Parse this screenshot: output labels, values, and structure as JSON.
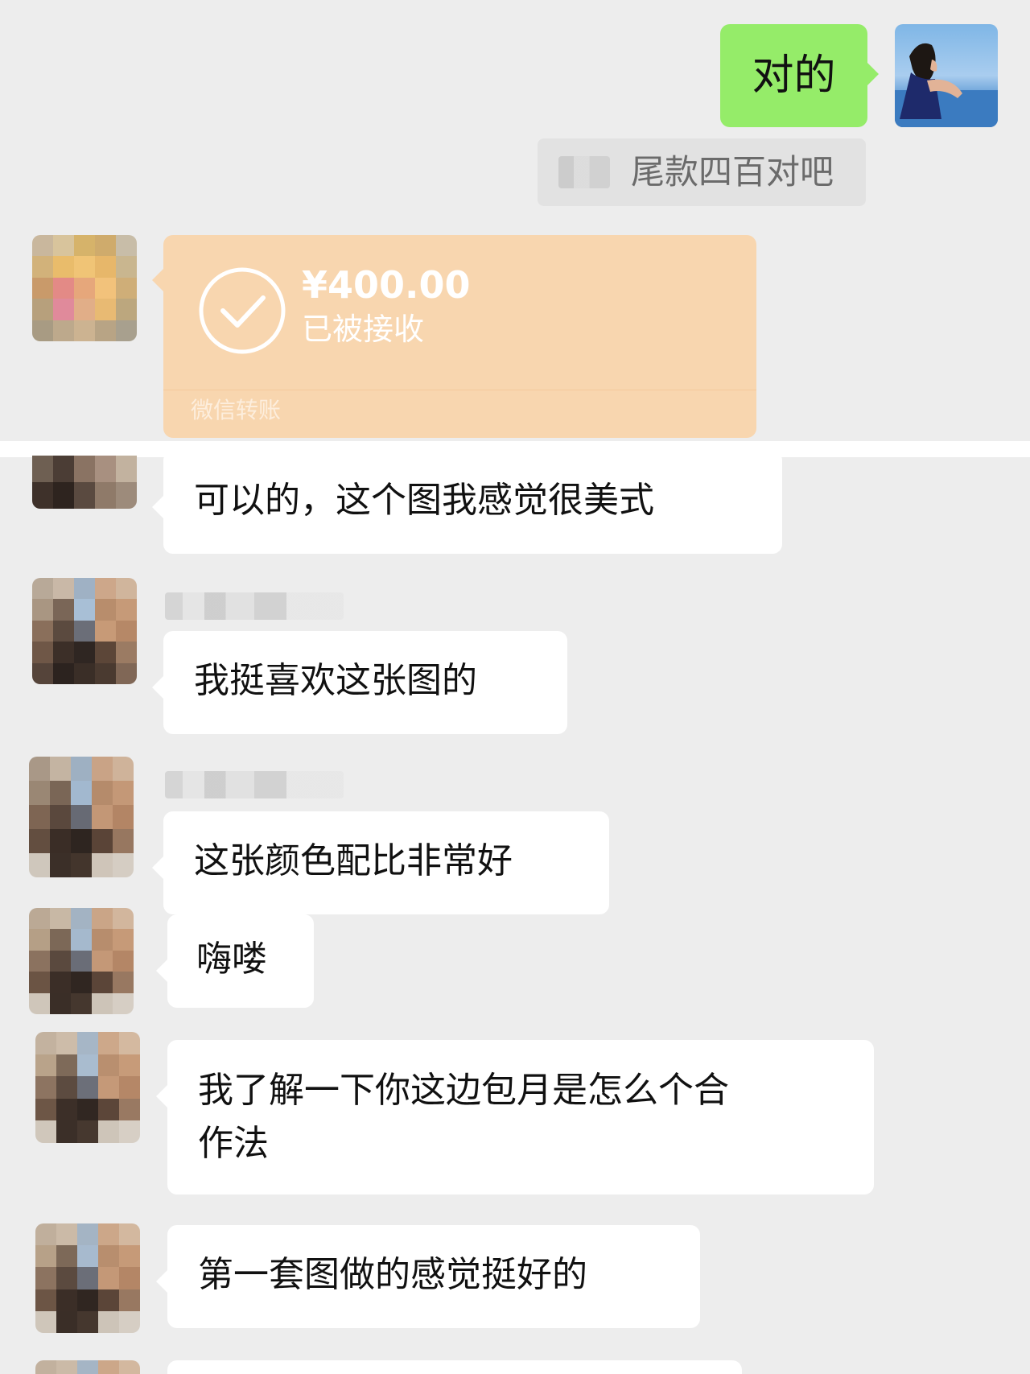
{
  "messages": {
    "m1": "对的",
    "quote": "尾款四百对吧",
    "transfer": {
      "amount": "¥400.00",
      "status": "已被接收",
      "footer": "微信转账"
    },
    "m2": "可以的，这个图我感觉很美式",
    "m3": "我挺喜欢这张图的",
    "m4": "这张颜色配比非常好",
    "m5": "嗨喽",
    "m6_line1": "我了解一下你这边包月是怎么个合",
    "m6_line2": "作法",
    "m7": "第一套图做的感觉挺好的"
  },
  "colors": {
    "background": "#ededed",
    "own_bubble": "#95ec69",
    "other_bubble": "#ffffff",
    "transfer_card": "#f8d6af",
    "transfer_text": "#ffffff"
  }
}
